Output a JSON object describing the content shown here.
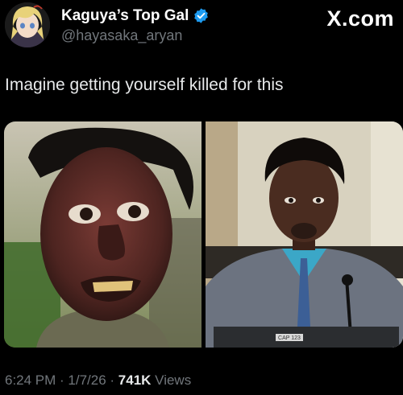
{
  "author": {
    "display_name": "Kaguya’s Top Gal",
    "handle": "@hayasaka_aryan",
    "verified": true
  },
  "watermark": "X.com",
  "post": {
    "text": "Imagine getting yourself killed for this"
  },
  "media": {
    "right_photo_laptop_sticker": "CAP 123"
  },
  "meta": {
    "time": "6:24 PM",
    "separator1": " · ",
    "date": "1/7/26",
    "separator2": " · ",
    "views_count": "741K",
    "views_label": " Views"
  },
  "colors": {
    "background": "#000000",
    "text_primary": "#e7e9ea",
    "text_secondary": "#71767b",
    "verified_blue": "#1d9bf0"
  }
}
